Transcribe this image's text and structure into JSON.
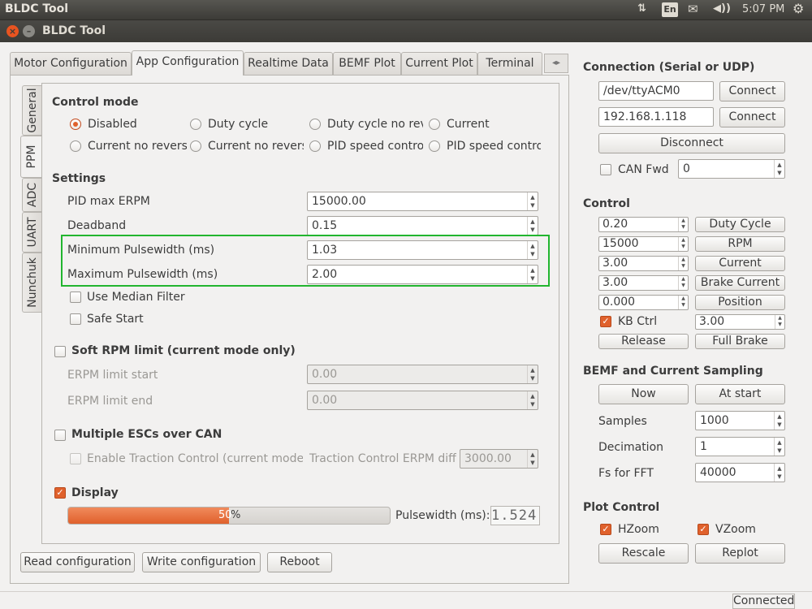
{
  "topbar": {
    "title": "BLDC Tool",
    "keyboard": "En",
    "time": "5:07 PM"
  },
  "window": {
    "title": "BLDC Tool"
  },
  "tabs": [
    "Motor Configuration",
    "App Configuration",
    "Realtime Data",
    "BEMF Plot",
    "Current Plot",
    "Terminal"
  ],
  "side_tabs": [
    "General",
    "PPM",
    "ADC",
    "UART",
    "Nunchuk"
  ],
  "control_mode": {
    "heading": "Control mode",
    "options": [
      "Disabled",
      "Duty cycle",
      "Duty cycle no reve",
      "Current",
      "Current no revers",
      "Current no revers",
      "PID speed control",
      "PID speed control"
    ],
    "selected": "Disabled"
  },
  "settings": {
    "heading": "Settings",
    "pid_max_erpm": {
      "label": "PID max ERPM",
      "value": "15000.00"
    },
    "deadband": {
      "label": "Deadband",
      "value": "0.15"
    },
    "min_pulse": {
      "label": "Minimum Pulsewidth (ms)",
      "value": "1.03"
    },
    "max_pulse": {
      "label": "Maximum Pulsewidth (ms)",
      "value": "2.00"
    },
    "median_filter": "Use Median Filter",
    "safe_start": "Safe Start"
  },
  "soft_rpm": {
    "label": "Soft RPM limit (current mode only)",
    "start": {
      "label": "ERPM limit start",
      "value": "0.00"
    },
    "end": {
      "label": "ERPM limit end",
      "value": "0.00"
    }
  },
  "multi_esc": {
    "label": "Multiple ESCs over CAN",
    "traction": "Enable Traction Control (current mode o",
    "erpm_diff": {
      "label": "Traction Control ERPM diff",
      "value": "3000.00"
    }
  },
  "display": {
    "label": "Display",
    "progress_value": 50,
    "progress_text": "50",
    "progress_suffix": "%",
    "pulsewidth_label": "Pulsewidth (ms):",
    "pulsewidth_value": "1.524"
  },
  "bottom_buttons": {
    "read": "Read configuration",
    "write": "Write configuration",
    "reboot": "Reboot"
  },
  "connection": {
    "heading": "Connection (Serial or UDP)",
    "serial_port": "/dev/ttyACM0",
    "udp_addr": "192.168.1.118",
    "connect": "Connect",
    "disconnect": "Disconnect",
    "can_fwd": "CAN Fwd",
    "can_id": "0"
  },
  "control": {
    "heading": "Control",
    "duty": {
      "value": "0.20",
      "button": "Duty Cycle"
    },
    "rpm": {
      "value": "15000",
      "button": "RPM"
    },
    "current": {
      "value": "3.00",
      "button": "Current"
    },
    "brake": {
      "value": "3.00",
      "button": "Brake Current"
    },
    "position": {
      "value": "0.000",
      "button": "Position"
    },
    "kb_ctrl": {
      "label": "KB Ctrl",
      "value": "3.00"
    },
    "release": "Release",
    "full_brake": "Full Brake"
  },
  "bemf": {
    "heading": "BEMF and Current Sampling",
    "now": "Now",
    "at_start": "At start",
    "samples": {
      "label": "Samples",
      "value": "1000"
    },
    "decimation": {
      "label": "Decimation",
      "value": "1"
    },
    "fs": {
      "label": "Fs for FFT",
      "value": "40000"
    }
  },
  "plot_control": {
    "heading": "Plot Control",
    "hzoom": "HZoom",
    "vzoom": "VZoom",
    "rescale": "Rescale",
    "replot": "Replot"
  },
  "status": "Connected",
  "colors": {
    "accent": "#e0612c",
    "highlight": "#22b52f"
  },
  "icons": [
    "network-arrows-icon",
    "keyboard-icon",
    "mail-icon",
    "volume-icon",
    "gear-icon",
    "close-icon",
    "minimize-icon",
    "scroll-left-icon",
    "scroll-right-icon"
  ]
}
